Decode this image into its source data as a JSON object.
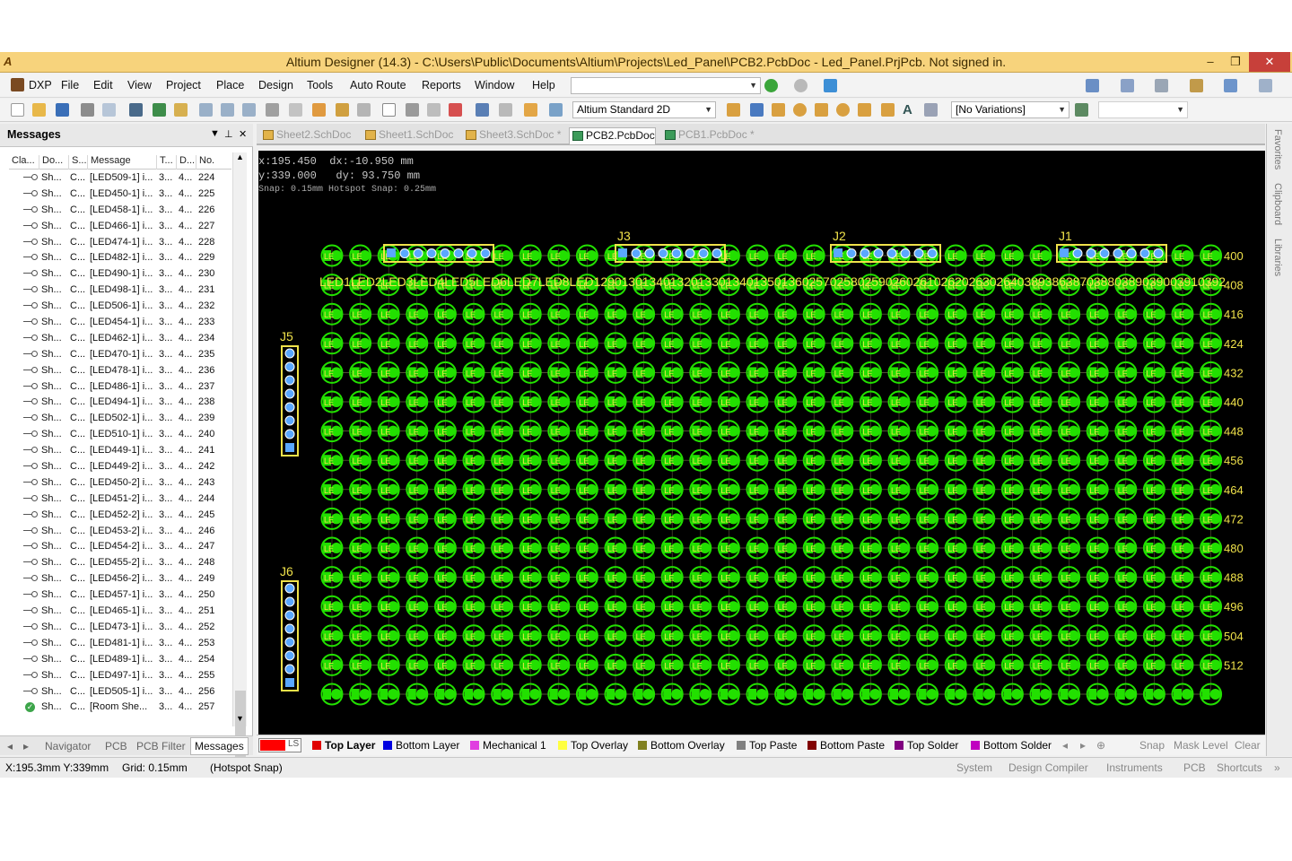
{
  "title_bar": {
    "title": "Altium Designer (14.3) - C:\\Users\\Public\\Documents\\Altium\\Projects\\Led_Panel\\PCB2.PcbDoc - Led_Panel.PrjPcb. Not signed in.",
    "minimize": "–",
    "restore": "❐",
    "close": "✕"
  },
  "menu": {
    "dxp": "DXP",
    "items": [
      "File",
      "Edit",
      "View",
      "Project",
      "Place",
      "Design",
      "Tools",
      "Auto Route",
      "Reports",
      "Window",
      "Help"
    ]
  },
  "toolbar": {
    "view_mode": "Altium Standard 2D",
    "variations": "[No Variations]"
  },
  "doc_tabs": [
    {
      "label": "Sheet2.SchDoc",
      "kind": "sch",
      "active": false
    },
    {
      "label": "Sheet1.SchDoc",
      "kind": "sch",
      "active": false
    },
    {
      "label": "Sheet3.SchDoc *",
      "kind": "sch",
      "active": false
    },
    {
      "label": "PCB2.PcbDoc",
      "kind": "pcb",
      "active": true
    },
    {
      "label": "PCB1.PcbDoc *",
      "kind": "pcb",
      "active": false
    }
  ],
  "messages_panel": {
    "title": "Messages",
    "columns": [
      "Cla...",
      "Do...",
      "S...",
      "Message",
      "T...",
      "D...",
      "No."
    ],
    "rows": [
      {
        "doc": "Sh...",
        "src": "C...",
        "msg": "[LED509-1] i...",
        "t": "3...",
        "d": "4...",
        "no": "224"
      },
      {
        "doc": "Sh...",
        "src": "C...",
        "msg": "[LED450-1] i...",
        "t": "3...",
        "d": "4...",
        "no": "225"
      },
      {
        "doc": "Sh...",
        "src": "C...",
        "msg": "[LED458-1] i...",
        "t": "3...",
        "d": "4...",
        "no": "226"
      },
      {
        "doc": "Sh...",
        "src": "C...",
        "msg": "[LED466-1] i...",
        "t": "3...",
        "d": "4...",
        "no": "227"
      },
      {
        "doc": "Sh...",
        "src": "C...",
        "msg": "[LED474-1] i...",
        "t": "3...",
        "d": "4...",
        "no": "228"
      },
      {
        "doc": "Sh...",
        "src": "C...",
        "msg": "[LED482-1] i...",
        "t": "3...",
        "d": "4...",
        "no": "229"
      },
      {
        "doc": "Sh...",
        "src": "C...",
        "msg": "[LED490-1] i...",
        "t": "3...",
        "d": "4...",
        "no": "230"
      },
      {
        "doc": "Sh...",
        "src": "C...",
        "msg": "[LED498-1] i...",
        "t": "3...",
        "d": "4...",
        "no": "231"
      },
      {
        "doc": "Sh...",
        "src": "C...",
        "msg": "[LED506-1] i...",
        "t": "3...",
        "d": "4...",
        "no": "232"
      },
      {
        "doc": "Sh...",
        "src": "C...",
        "msg": "[LED454-1] i...",
        "t": "3...",
        "d": "4...",
        "no": "233"
      },
      {
        "doc": "Sh...",
        "src": "C...",
        "msg": "[LED462-1] i...",
        "t": "3...",
        "d": "4...",
        "no": "234"
      },
      {
        "doc": "Sh...",
        "src": "C...",
        "msg": "[LED470-1] i...",
        "t": "3...",
        "d": "4...",
        "no": "235"
      },
      {
        "doc": "Sh...",
        "src": "C...",
        "msg": "[LED478-1] i...",
        "t": "3...",
        "d": "4...",
        "no": "236"
      },
      {
        "doc": "Sh...",
        "src": "C...",
        "msg": "[LED486-1] i...",
        "t": "3...",
        "d": "4...",
        "no": "237"
      },
      {
        "doc": "Sh...",
        "src": "C...",
        "msg": "[LED494-1] i...",
        "t": "3...",
        "d": "4...",
        "no": "238"
      },
      {
        "doc": "Sh...",
        "src": "C...",
        "msg": "[LED502-1] i...",
        "t": "3...",
        "d": "4...",
        "no": "239"
      },
      {
        "doc": "Sh...",
        "src": "C...",
        "msg": "[LED510-1] i...",
        "t": "3...",
        "d": "4...",
        "no": "240"
      },
      {
        "doc": "Sh...",
        "src": "C...",
        "msg": "[LED449-1] i...",
        "t": "3...",
        "d": "4...",
        "no": "241"
      },
      {
        "doc": "Sh...",
        "src": "C...",
        "msg": "[LED449-2] i...",
        "t": "3...",
        "d": "4...",
        "no": "242"
      },
      {
        "doc": "Sh...",
        "src": "C...",
        "msg": "[LED450-2] i...",
        "t": "3...",
        "d": "4...",
        "no": "243"
      },
      {
        "doc": "Sh...",
        "src": "C...",
        "msg": "[LED451-2] i...",
        "t": "3...",
        "d": "4...",
        "no": "244"
      },
      {
        "doc": "Sh...",
        "src": "C...",
        "msg": "[LED452-2] i...",
        "t": "3...",
        "d": "4...",
        "no": "245"
      },
      {
        "doc": "Sh...",
        "src": "C...",
        "msg": "[LED453-2] i...",
        "t": "3...",
        "d": "4...",
        "no": "246"
      },
      {
        "doc": "Sh...",
        "src": "C...",
        "msg": "[LED454-2] i...",
        "t": "3...",
        "d": "4...",
        "no": "247"
      },
      {
        "doc": "Sh...",
        "src": "C...",
        "msg": "[LED455-2] i...",
        "t": "3...",
        "d": "4...",
        "no": "248"
      },
      {
        "doc": "Sh...",
        "src": "C...",
        "msg": "[LED456-2] i...",
        "t": "3...",
        "d": "4...",
        "no": "249"
      },
      {
        "doc": "Sh...",
        "src": "C...",
        "msg": "[LED457-1] i...",
        "t": "3...",
        "d": "4...",
        "no": "250"
      },
      {
        "doc": "Sh...",
        "src": "C...",
        "msg": "[LED465-1] i...",
        "t": "3...",
        "d": "4...",
        "no": "251"
      },
      {
        "doc": "Sh...",
        "src": "C...",
        "msg": "[LED473-1] i...",
        "t": "3...",
        "d": "4...",
        "no": "252"
      },
      {
        "doc": "Sh...",
        "src": "C...",
        "msg": "[LED481-1] i...",
        "t": "3...",
        "d": "4...",
        "no": "253"
      },
      {
        "doc": "Sh...",
        "src": "C...",
        "msg": "[LED489-1] i...",
        "t": "3...",
        "d": "4...",
        "no": "254"
      },
      {
        "doc": "Sh...",
        "src": "C...",
        "msg": "[LED497-1] i...",
        "t": "3...",
        "d": "4...",
        "no": "255"
      },
      {
        "doc": "Sh...",
        "src": "C...",
        "msg": "[LED505-1] i...",
        "t": "3...",
        "d": "4...",
        "no": "256"
      },
      {
        "doc": "Sh...",
        "src": "C...",
        "msg": "[Room She...",
        "t": "3...",
        "d": "4...",
        "no": "257",
        "ok": true
      }
    ],
    "bottom_tabs": [
      "Navigator",
      "PCB",
      "PCB Filter",
      "Messages"
    ]
  },
  "canvas": {
    "coord_x": "x:195.450",
    "coord_y": "y:339.000",
    "dx": "dx:-10.950 mm",
    "dy": "dy: 93.750 mm",
    "snap_info": "Snap: 0.15mm Hotspot Snap: 0.25mm",
    "connectors": [
      "J3",
      "J2",
      "J1",
      "J5",
      "J6"
    ],
    "led_header": "LED1LED2LED3LED4LED5LED6LED7LED8LED1290130134013201330134013501360257025802590260261026202630264038938638703880389039003910392",
    "row_numbers": [
      "400",
      "408",
      "416",
      "424",
      "432",
      "440",
      "448",
      "456",
      "464",
      "472",
      "480",
      "488",
      "496",
      "504",
      "512"
    ],
    "board_color": "#000000",
    "pad_color": "#22e000",
    "silk_color": "#f0e24a"
  },
  "right_sidebar": [
    "Favorites",
    "Clipboard",
    "Libraries"
  ],
  "layers": {
    "current_color": "#ff0000",
    "current_label": "LS",
    "items": [
      {
        "name": "Top Layer",
        "color": "#e00000"
      },
      {
        "name": "Bottom Layer",
        "color": "#0000e0"
      },
      {
        "name": "Mechanical 1",
        "color": "#e040e0"
      },
      {
        "name": "Top Overlay",
        "color": "#ffff40"
      },
      {
        "name": "Bottom Overlay",
        "color": "#808020"
      },
      {
        "name": "Top Paste",
        "color": "#808080"
      },
      {
        "name": "Bottom Paste",
        "color": "#800000"
      },
      {
        "name": "Top Solder",
        "color": "#800080"
      },
      {
        "name": "Bottom Solder",
        "color": "#c000c0"
      }
    ],
    "buttons": [
      "Snap",
      "Mask Level",
      "Clear"
    ]
  },
  "status": {
    "position": "X:195.3mm Y:339mm",
    "grid": "Grid: 0.15mm",
    "snap": "(Hotspot Snap)",
    "right": [
      "System",
      "Design Compiler",
      "Instruments",
      "PCB",
      "Shortcuts"
    ]
  }
}
